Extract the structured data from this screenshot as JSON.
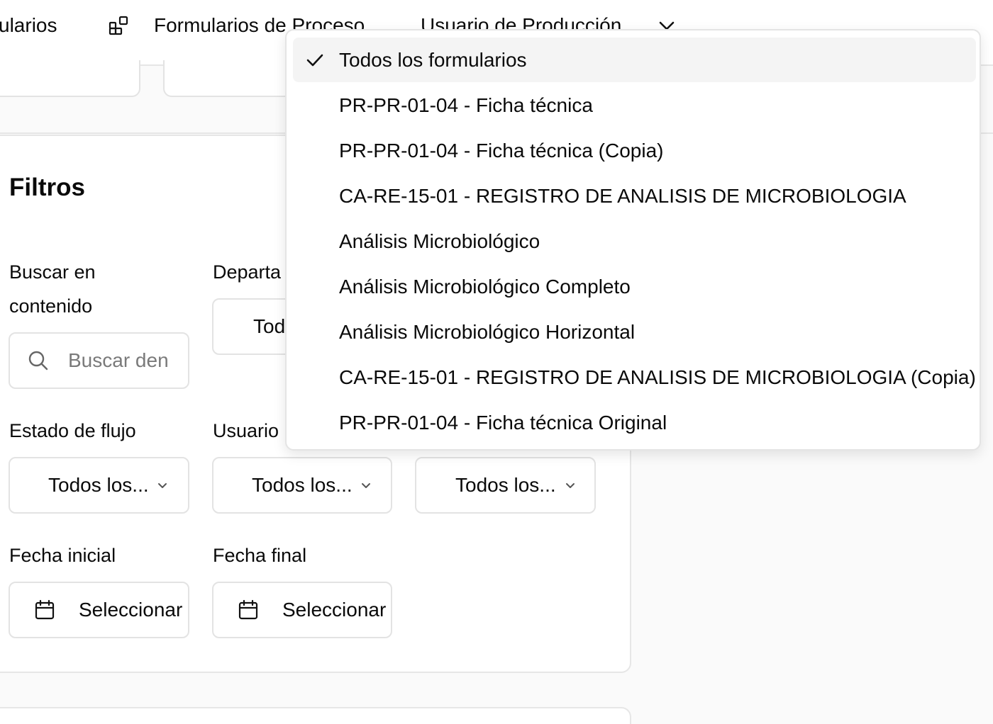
{
  "nav": {
    "partial_left": "ularios",
    "process_forms": "Formularios de Proceso",
    "production_user": "Usuario de Producción"
  },
  "filters": {
    "title": "Filtros",
    "search": {
      "label_line1": "Buscar en",
      "label_line2": "contenido",
      "placeholder": "Buscar den"
    },
    "department": {
      "label": "Departa",
      "value": "Tod"
    },
    "flow_state": {
      "label": "Estado de flujo",
      "value": "Todos los..."
    },
    "user": {
      "label": "Usuario",
      "value": "Todos los..."
    },
    "third": {
      "value": "Todos los..."
    },
    "start_date": {
      "label": "Fecha inicial",
      "value": "Seleccionar"
    },
    "end_date": {
      "label": "Fecha final",
      "value": "Seleccionar"
    }
  },
  "dropdown": {
    "selected_index": 0,
    "options": [
      "Todos los formularios",
      "PR-PR-01-04 - Ficha técnica",
      "PR-PR-01-04 - Ficha técnica (Copia)",
      "CA-RE-15-01 - REGISTRO DE ANALISIS DE MICROBIOLOGIA",
      "Análisis Microbiológico",
      "Análisis Microbiológico Completo",
      "Análisis Microbiológico Horizontal",
      "CA-RE-15-01 - REGISTRO DE ANALISIS DE MICROBIOLOGIA (Copia)",
      "PR-PR-01-04 - Ficha técnica Original"
    ]
  },
  "icons": {
    "nav_forms": "forms-grid-icon",
    "nav_chevron": "chevron-down-icon",
    "search": "search-icon",
    "calendar": "calendar-icon",
    "check": "check-icon"
  }
}
